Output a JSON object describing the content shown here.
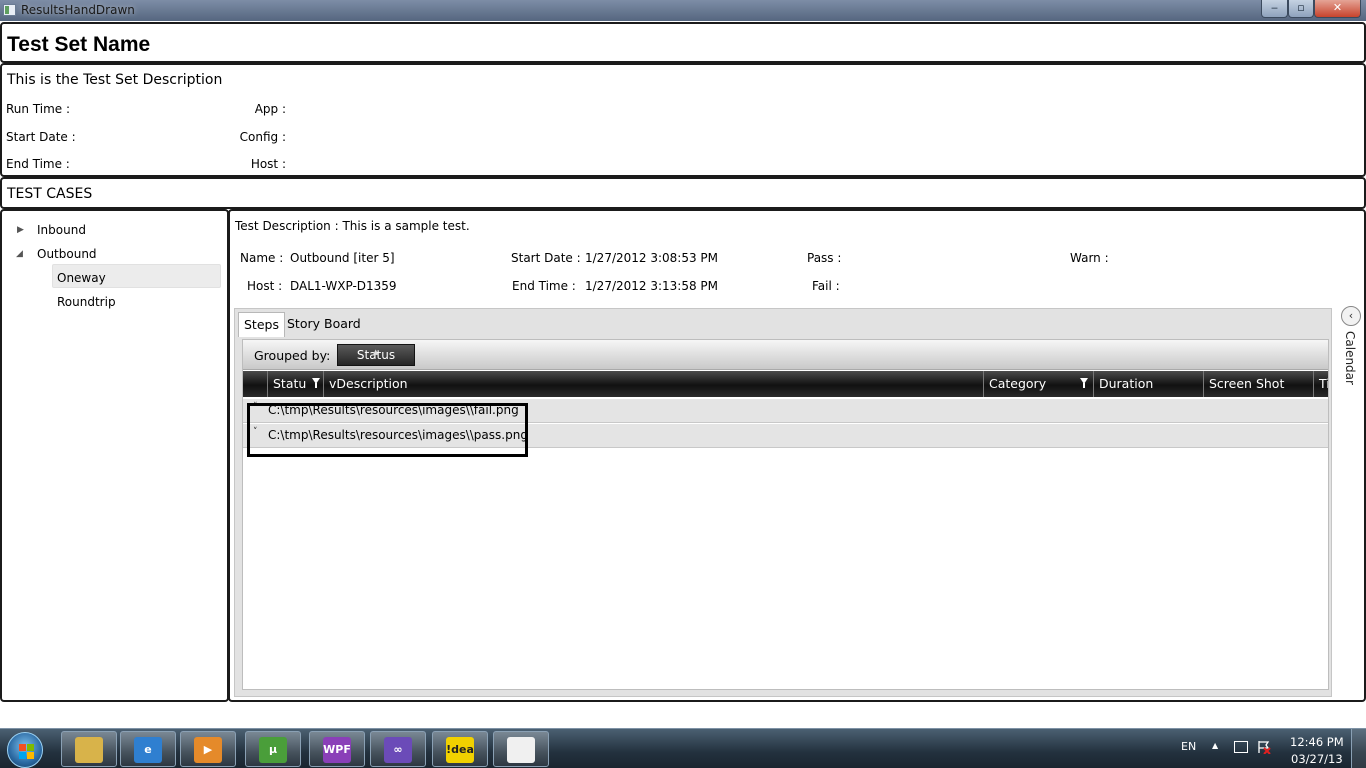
{
  "window": {
    "title": "ResultsHandDrawn",
    "minimize_glyph": "‒",
    "maximize_glyph": "▫",
    "close_glyph": "✕"
  },
  "test_set": {
    "name": "Test Set Name",
    "description": "This is the Test Set Description",
    "run_time_label": "Run Time :",
    "start_date_label": "Start Date :",
    "end_time_label": "End Time :",
    "app_label": "App :",
    "config_label": "Config :",
    "host_label": "Host :"
  },
  "test_cases_header": "TEST CASES",
  "tree": {
    "inbound": "Inbound",
    "outbound": "Outbound",
    "oneway": "Oneway",
    "roundtrip": "Roundtrip",
    "collapsed_arrow": "▶",
    "expanded_arrow": "◢"
  },
  "detail": {
    "test_description": "Test Description : This is a sample test.",
    "name_label": "Name :",
    "name_value": "Outbound [iter 5]",
    "host_label": "Host :",
    "host_value": "DAL1-WXP-D1359",
    "start_date_label": "Start Date :",
    "start_date_value": "1/27/2012 3:08:53 PM",
    "end_time_label": "End Time :",
    "end_time_value": "1/27/2012 3:13:58 PM",
    "pass_label": "Pass :",
    "fail_label": "Fail :",
    "warn_label": "Warn :"
  },
  "tabs": {
    "steps": "Steps",
    "story_board": "Story Board"
  },
  "grid": {
    "grouped_by_label": "Grouped by:",
    "group_chip": "Status",
    "columns": {
      "status": "Statu",
      "description": "vDescription",
      "category": "Category",
      "duration": "Duration",
      "screen_shot": "Screen Shot",
      "t": "Ti"
    },
    "rows": [
      {
        "text": "C:\\tmp\\Results\\resources\\images\\\\fail.png"
      },
      {
        "text": "C:\\tmp\\Results\\resources\\images\\\\pass.png"
      }
    ],
    "row_chevron": "˅"
  },
  "side": {
    "calendar_label": "Calendar",
    "calendar_glyph": "‹"
  },
  "taskbar": {
    "apps": [
      {
        "name": "explorer",
        "glyph": "",
        "color": "#d8b34a"
      },
      {
        "name": "internet-explorer",
        "glyph": "e",
        "color": "#2f7fd0"
      },
      {
        "name": "media-player",
        "glyph": "▶",
        "color": "#e58a2a"
      },
      {
        "name": "utorrent",
        "glyph": "µ",
        "color": "#4a9e3a"
      },
      {
        "name": "wpf",
        "glyph": "WPF",
        "color": "#8a3fb8"
      },
      {
        "name": "visual-studio",
        "glyph": "∞",
        "color": "#6b4bb8"
      },
      {
        "name": "idea",
        "glyph": "!dea",
        "color": "#f1d100"
      },
      {
        "name": "document",
        "glyph": "",
        "color": "#f0f0f0"
      }
    ],
    "language": "EN",
    "tray_up": "▲",
    "time": "12:46 PM",
    "date": "03/27/13"
  }
}
